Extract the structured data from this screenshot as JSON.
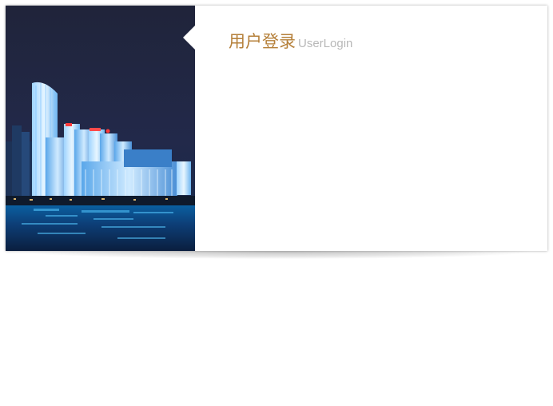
{
  "login": {
    "title_cn": "用户登录",
    "title_en": "UserLogin"
  },
  "image": {
    "subject": "city-skyline-night-icon"
  },
  "colors": {
    "title_accent": "#b5803a",
    "subtitle": "#b8b8b8",
    "card_bg": "#ffffff"
  }
}
